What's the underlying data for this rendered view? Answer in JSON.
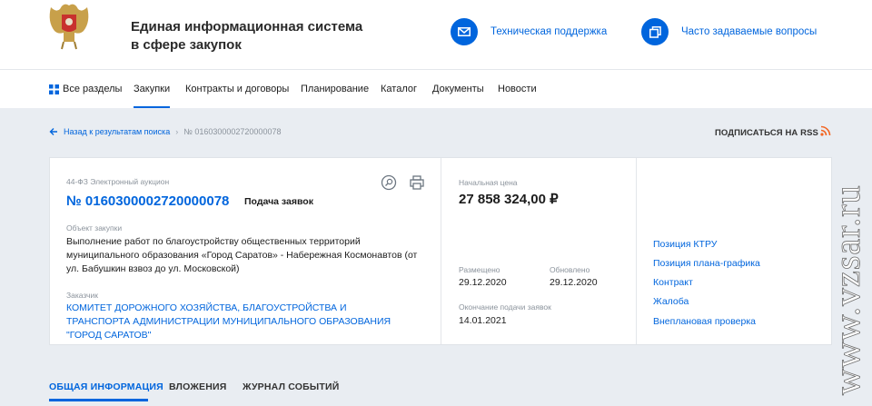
{
  "header": {
    "title_line1": "Единая информационная система",
    "title_line2": "в сфере закупок",
    "support_label": "Техническая поддержка",
    "faq_label": "Часто задаваемые вопросы",
    "support_icon": "mail-icon",
    "faq_icon": "copy-icon"
  },
  "nav": {
    "items": [
      {
        "label": "Все разделы",
        "icon": "grid-icon"
      },
      {
        "label": "Закупки",
        "active": true
      },
      {
        "label": "Контракты и договоры"
      },
      {
        "label": "Планирование"
      },
      {
        "label": "Каталог"
      },
      {
        "label": "Документы"
      },
      {
        "label": "Новости"
      }
    ]
  },
  "breadcrumb": {
    "back_label": "Назад к результатам поиска",
    "separator": "›",
    "current": "№ 0160300002720000078"
  },
  "rss": {
    "label": "ПОДПИСАТЬСЯ НА RSS",
    "icon": "rss-icon"
  },
  "purchase": {
    "law": "44-ФЗ Электронный аукцион",
    "number": "№ 0160300002720000078",
    "status": "Подача заявок",
    "object_label": "Объект закупки",
    "object_value": "Выполнение работ по благоустройству общественных территорий муниципального образования «Город Саратов» - Набережная Космонавтов (от ул. Бабушкин взвоз до ул. Московской)",
    "customer_label": "Заказчик",
    "customer_value": "КОМИТЕТ ДОРОЖНОГО ХОЗЯЙСТВА, БЛАГОУСТРОЙСТВА И ТРАНСПОРТА АДМИНИСТРАЦИИ МУНИЦИПАЛЬНОГО ОБРАЗОВАНИЯ \"ГОРОД САРАТОВ\"",
    "price_label": "Начальная цена",
    "price_value": "27 858 324,00 ₽",
    "posted_label": "Размещено",
    "posted_value": "29.12.2020",
    "updated_label": "Обновлено",
    "updated_value": "29.12.2020",
    "deadline_label": "Окончание подачи заявок",
    "deadline_value": "14.01.2021",
    "action_icons": [
      "search-plus-icon",
      "printer-icon"
    ]
  },
  "links": [
    "Позиция КТРУ",
    "Позиция плана-графика",
    "Контракт",
    "Жалоба",
    "Внеплановая проверка"
  ],
  "tabs": [
    {
      "label": "ОБЩАЯ ИНФОРМАЦИЯ",
      "active": true
    },
    {
      "label": "ВЛОЖЕНИЯ"
    },
    {
      "label": "ЖУРНАЛ СОБЫТИЙ"
    }
  ],
  "watermark": "www.vzsar.ru",
  "colors": {
    "accent": "#0065dd",
    "background": "#e9edf2",
    "rss": "#f26522"
  }
}
